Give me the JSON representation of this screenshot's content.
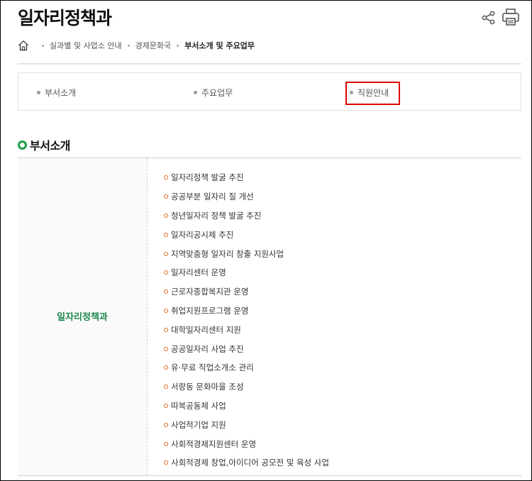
{
  "page": {
    "title": "일자리정책과"
  },
  "icons": {
    "share": "share-icon",
    "print": "print-icon",
    "home": "home-icon"
  },
  "breadcrumb": {
    "items": [
      "실과별 및 사업소 안내",
      "경제문화국",
      "부서소개 및 주요업무"
    ]
  },
  "tabs": [
    {
      "label": "부서소개"
    },
    {
      "label": "주요업무"
    },
    {
      "label": "직원안내"
    }
  ],
  "section": {
    "title": "부서소개"
  },
  "department": {
    "name": "일자리정책과",
    "duties": [
      "일자리정책 발굴 추진",
      "공공부분 일자리 질 개선",
      "청년일자리 정책 발굴 추진",
      "일자리공시제 추진",
      "지역맞춤형 일자리 창출 지원사업",
      "일자리센터 운영",
      "근로자종합복지관 운영",
      "취업지원프로그램 운영",
      "대학일자리센터 지원",
      "공공일자리 사업 추진",
      "유·무료 직업소개소 관리",
      "서랑동 문화마을 조성",
      "따복공동체 사업",
      "사업적기업 지원",
      "사회적경제지원센터 운영",
      "사회적경제 창업,아이디어 공모전 및 육성 사업"
    ]
  },
  "colors": {
    "accent_green": "#1c8a4c",
    "bullet_orange": "#e56a1f",
    "highlight_red": "#e00000"
  }
}
